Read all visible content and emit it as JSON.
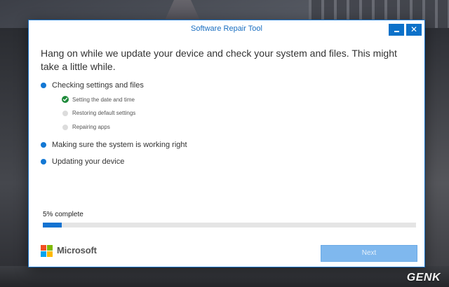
{
  "window": {
    "title": "Software Repair Tool",
    "minimize_icon": "minimize-icon",
    "close_icon": "close-icon",
    "close_glyph": "✕"
  },
  "headline": "Hang on while we update your device and check your system and files. This might take a little while.",
  "stages": [
    {
      "label": "Checking settings and files",
      "status": "active",
      "substeps": [
        {
          "label": "Setting the date and time",
          "status": "done",
          "icon": "check-icon"
        },
        {
          "label": "Restoring default settings",
          "status": "pending"
        },
        {
          "label": "Repairing apps",
          "status": "pending"
        }
      ]
    },
    {
      "label": "Making sure the system is working right",
      "status": "pending"
    },
    {
      "label": "Updating your device",
      "status": "pending"
    }
  ],
  "progress": {
    "label": "5% complete",
    "value": 0.05
  },
  "footer": {
    "brand": "Microsoft",
    "next_label": "Next",
    "next_enabled": false
  },
  "watermark": "GENK",
  "colors": {
    "accent": "#1373d1",
    "title_text": "#1a6fc1",
    "done_green": "#1e8a3a",
    "pending_gray": "#dcdcdc",
    "next_disabled": "#7fb8ee",
    "ms_red": "#f25022",
    "ms_green": "#7fba00",
    "ms_blue": "#00a4ef",
    "ms_yellow": "#ffb900"
  }
}
